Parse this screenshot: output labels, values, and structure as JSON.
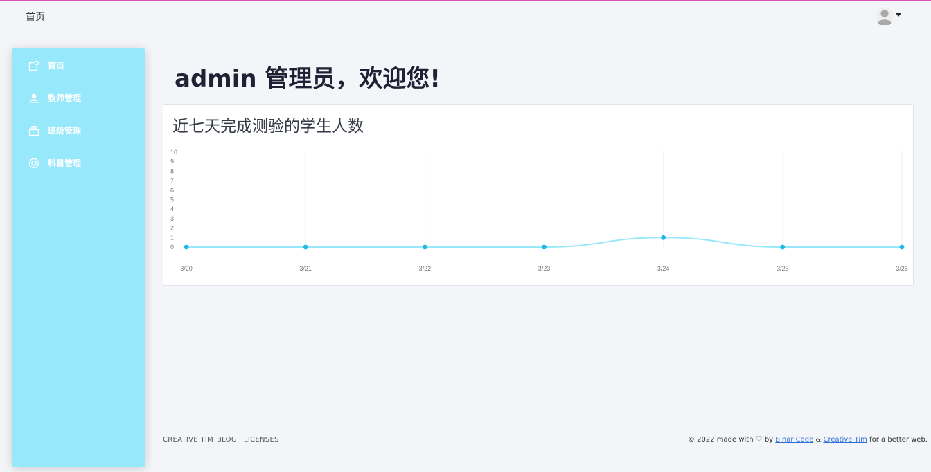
{
  "header": {
    "title": "首页",
    "avatar_icon": "user-avatar-icon"
  },
  "sidebar": {
    "items": [
      {
        "label": "首页",
        "icon": "home-icon"
      },
      {
        "label": "教师管理",
        "icon": "teacher-icon"
      },
      {
        "label": "班级管理",
        "icon": "class-icon"
      },
      {
        "label": "科目管理",
        "icon": "subject-icon"
      }
    ]
  },
  "main": {
    "welcome": "admin 管理员，欢迎您!"
  },
  "chart_data": {
    "type": "line",
    "title": "近七天完成测验的学生人数",
    "categories": [
      "3/20",
      "3/21",
      "3/22",
      "3/23",
      "3/24",
      "3/25",
      "3/26"
    ],
    "values": [
      0,
      0,
      0,
      0,
      1,
      0,
      0
    ],
    "ylim": [
      0,
      10
    ],
    "yticks": [
      "0",
      "1",
      "2",
      "3",
      "4",
      "5",
      "6",
      "7",
      "8",
      "9",
      "10"
    ],
    "line_color": "#98e8fc",
    "point_color": "#1db8e6",
    "grid": "vertical"
  },
  "footer": {
    "links": [
      "CREATIVE TIM",
      "BLOG",
      "LICENSES"
    ],
    "copyright_prefix": "© 2022 made with",
    "by": "by",
    "link1": "Binar Code",
    "amp": "&",
    "link2": "Creative Tim",
    "suffix": "for a better web."
  },
  "colors": {
    "accent_top_border": "#e14eca",
    "sidebar_bg": "#98e8fc",
    "page_bg": "#f4f5f9"
  }
}
